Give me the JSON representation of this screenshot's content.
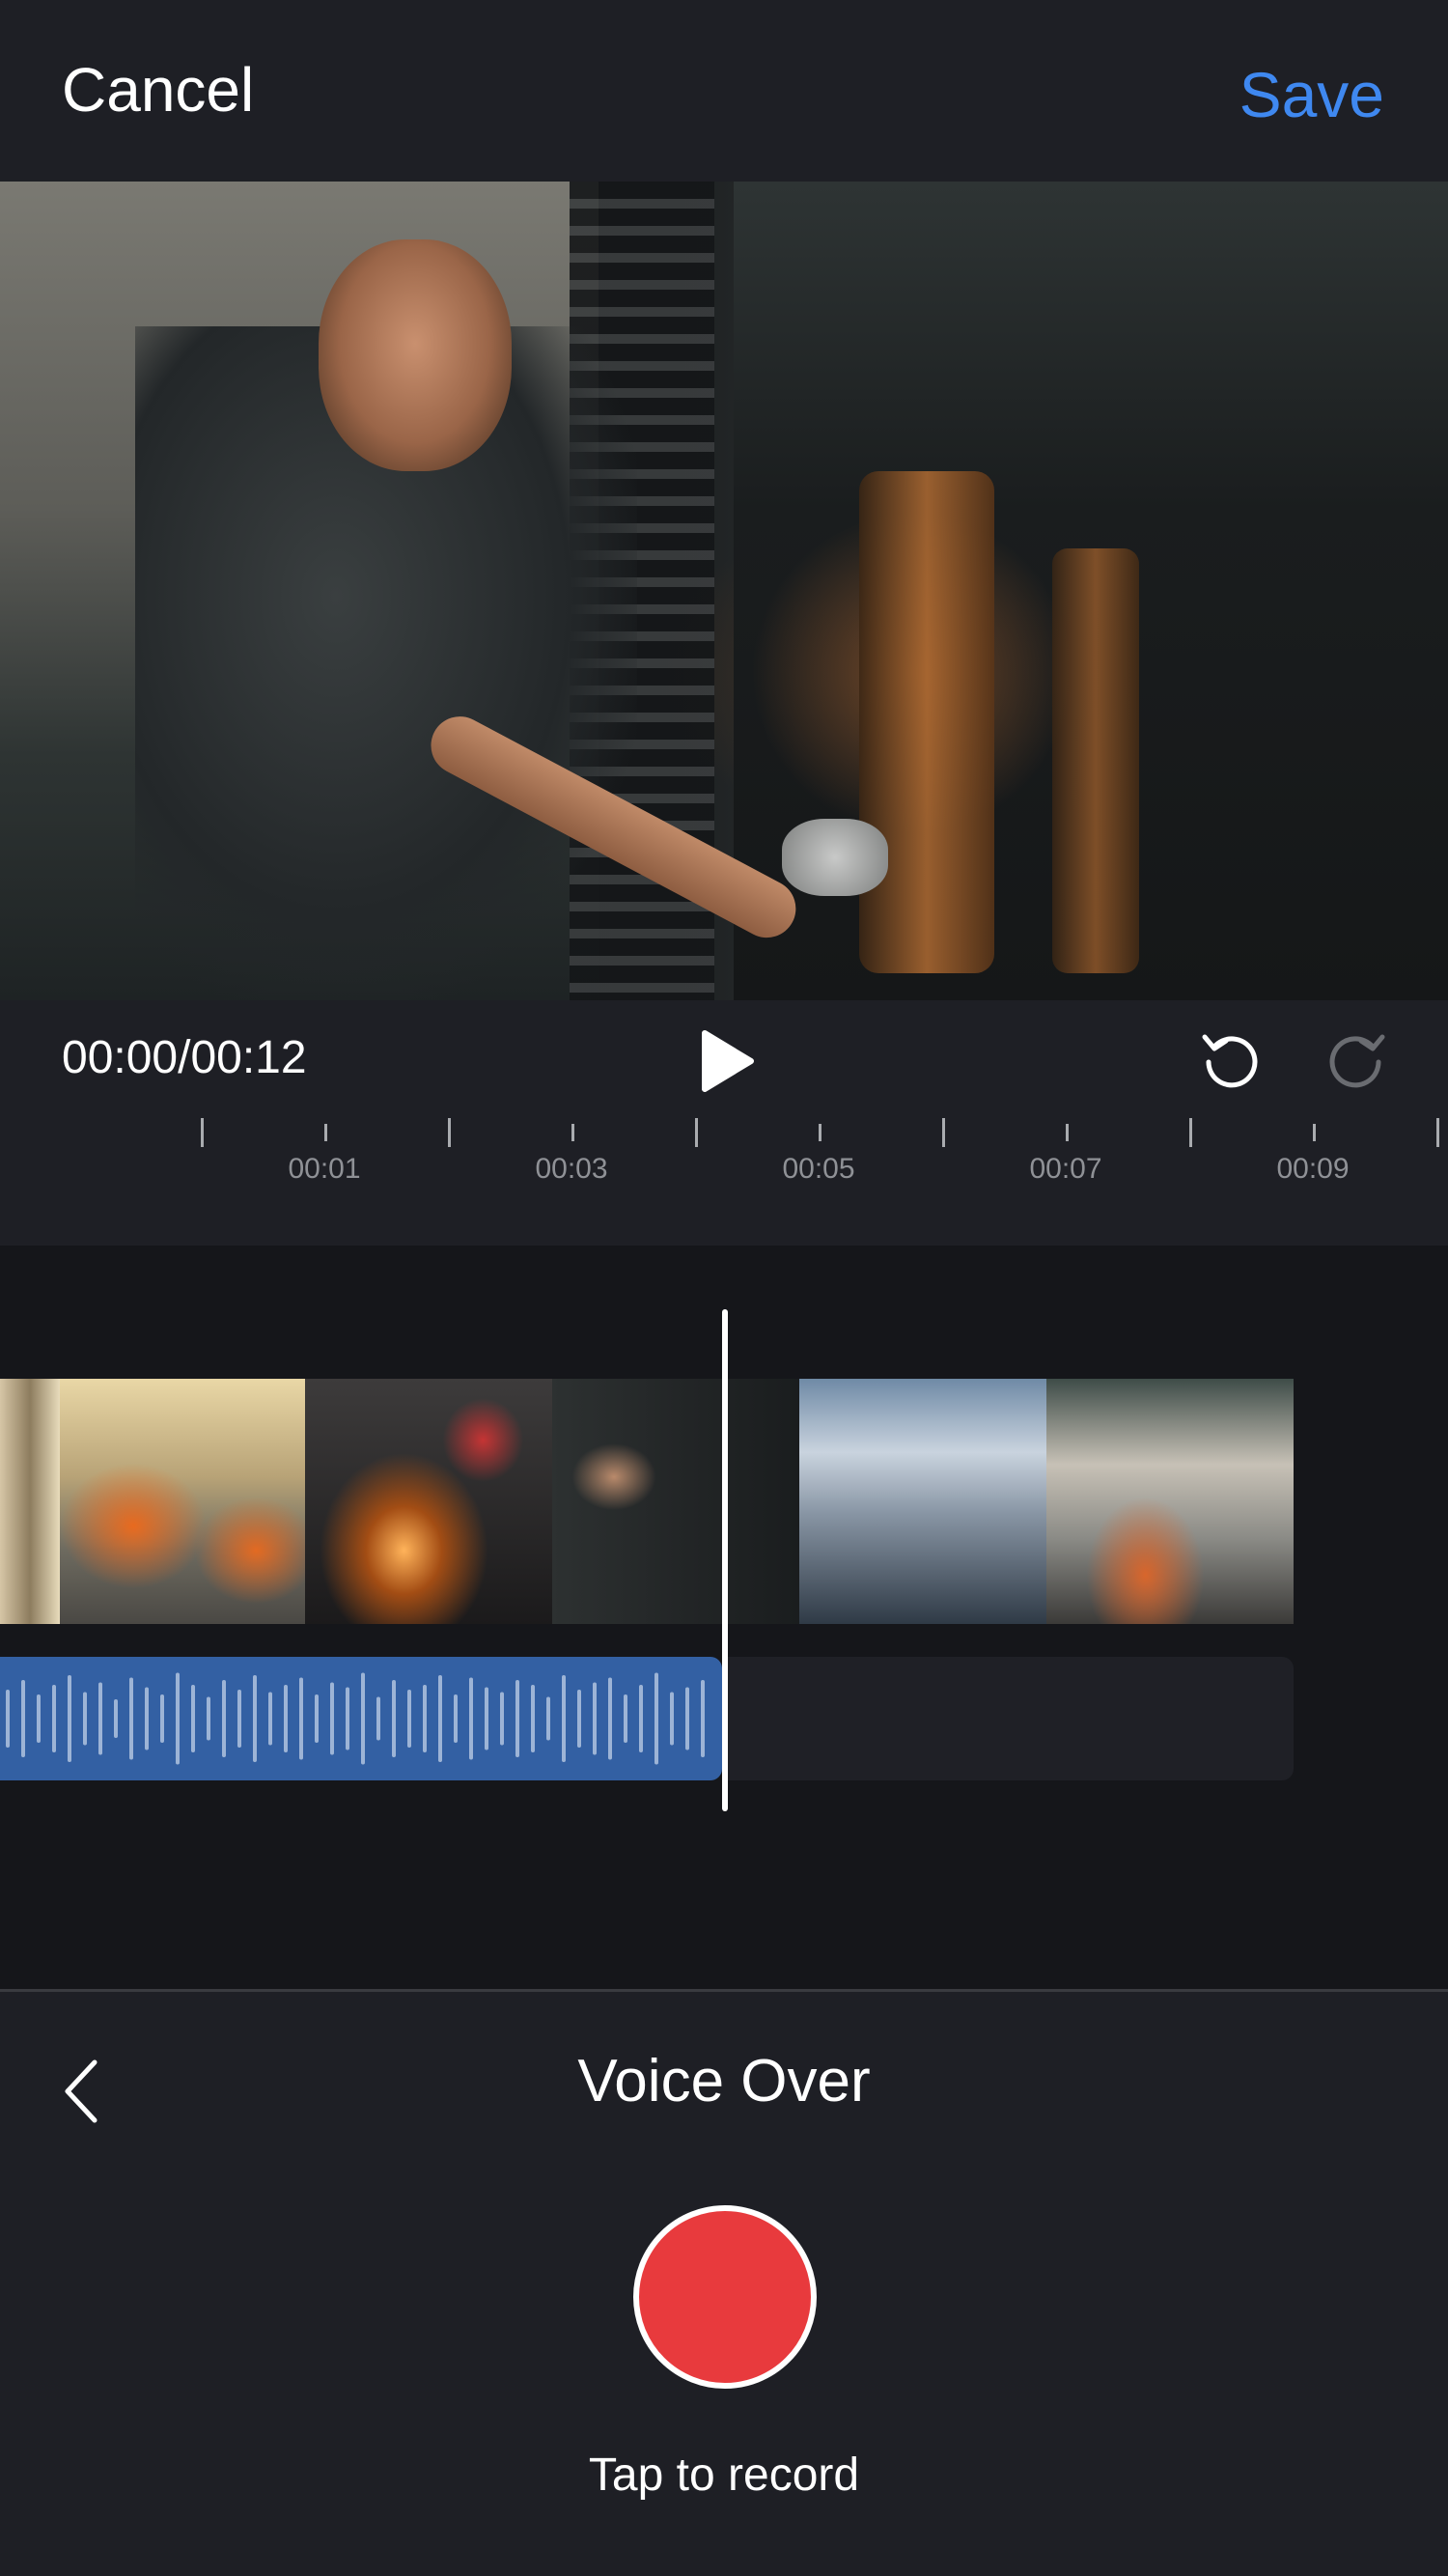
{
  "header": {
    "cancel_label": "Cancel",
    "save_label": "Save",
    "accent": "#3f88f0"
  },
  "player": {
    "time": "00:00/00:12",
    "play_icon": "play-icon",
    "undo_icon": "undo-icon",
    "redo_icon": "redo-icon"
  },
  "ruler": {
    "labels": [
      "00:01",
      "00:03",
      "00:05",
      "00:07",
      "00:09"
    ]
  },
  "panel": {
    "title": "Voice Over",
    "hint": "Tap to record",
    "back_icon": "chevron-left-icon",
    "record_color": "#e83a3d"
  },
  "audio": {
    "color": "#3360a3"
  }
}
